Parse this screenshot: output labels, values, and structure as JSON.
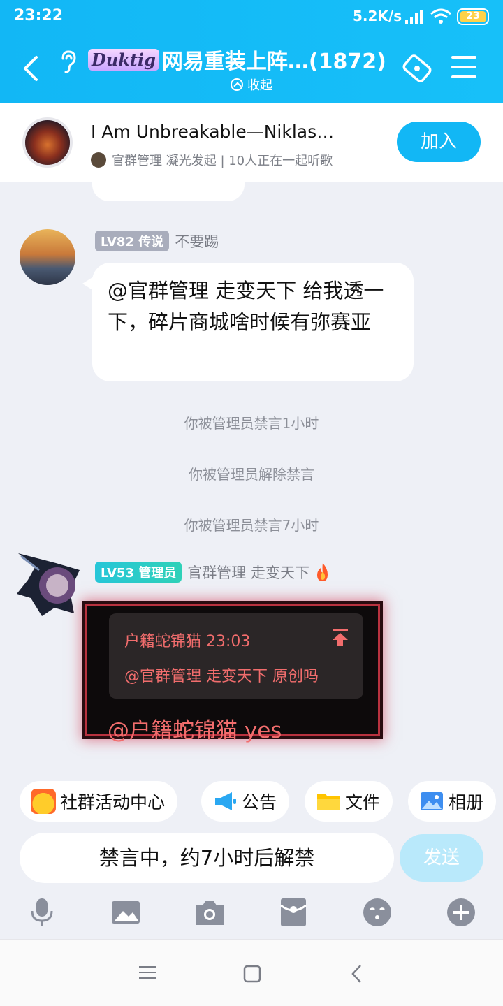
{
  "status_bar": {
    "time": "23:22",
    "network_speed": "5.2K/s",
    "battery": "23"
  },
  "header": {
    "brand": "Duktig",
    "title": "网易重装上阵…(1872)",
    "collapse_label": "收起"
  },
  "music": {
    "song": "I Am Unbreakable—Niklas…",
    "meta": "官群管理 凝光发起 | 10人正在一起听歌",
    "join_label": "加入"
  },
  "messages": [
    {
      "level": "LV82",
      "badge": "传说",
      "sender": "不要踢",
      "text": "@官群管理 走变天下 给我透一下，碎片商城啥时候有弥赛亚"
    }
  ],
  "system_messages": [
    "你被管理员禁言1小时",
    "你被管理员解除禁言",
    "你被管理员禁言7小时"
  ],
  "admin_message": {
    "level": "LV53",
    "badge": "管理员",
    "sender": "官群管理 走变天下",
    "quote_header": "户籍蛇锦猫 23:03",
    "quote_text": "@官群管理 走变天下 原创吗",
    "reply": "@户籍蛇锦猫 yes"
  },
  "shortcuts": [
    {
      "label": "社群活动中心",
      "icon": "community-icon"
    },
    {
      "label": "公告",
      "icon": "megaphone-icon"
    },
    {
      "label": "文件",
      "icon": "folder-icon"
    },
    {
      "label": "相册",
      "icon": "photo-icon"
    }
  ],
  "input": {
    "muted_text": "禁言中，约7小时后解禁",
    "send_label": "发送"
  },
  "toolbar": [
    "mic-icon",
    "image-icon",
    "camera-icon",
    "red-packet-icon",
    "emoji-icon",
    "plus-icon"
  ],
  "colors": {
    "accent": "#12b7f5",
    "quote_text": "#f26d6d",
    "admin_bubble_border": "#b8323f"
  }
}
